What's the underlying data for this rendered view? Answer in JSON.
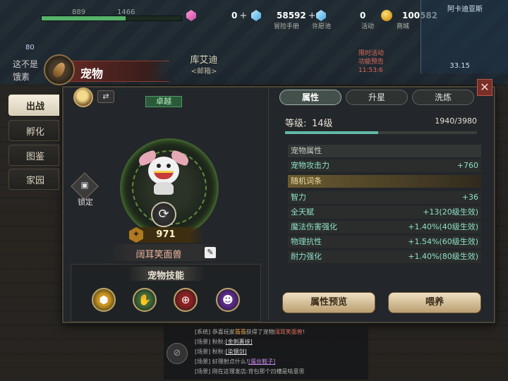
{
  "hud": {
    "hp_current": "889",
    "hp_max": "1466",
    "hp_fill_ratio": 0.6,
    "level": "80",
    "scrap_lines": [
      "这不是",
      "饿素"
    ],
    "currencies": [
      {
        "icon": "pink-crystal-icon",
        "value": "0",
        "plus": "+"
      },
      {
        "icon": "blue-crystal-icon",
        "value": "58592",
        "plus": "+"
      },
      {
        "icon": "blue-diamond-icon",
        "value": "0",
        "plus": ""
      },
      {
        "icon": "gold-coin-icon",
        "value": "100582",
        "plus": ""
      }
    ],
    "menu": [
      "冒险手册",
      "许愿池",
      "活动",
      "商城"
    ],
    "location": "阿卡迪亚斯",
    "time": "33.15",
    "npc_name": "库艾迪",
    "npc_sub": "<邮箱>",
    "npc_notes": [
      "限时活动",
      "功能预告",
      "11:53:6"
    ]
  },
  "panel": {
    "title": "宠物",
    "close_label": "✕",
    "side_tabs": [
      {
        "label": "出战",
        "active": true
      },
      {
        "label": "孵化",
        "active": false
      },
      {
        "label": "图鉴",
        "active": false
      },
      {
        "label": "家园",
        "active": false
      }
    ],
    "swap_label": "⇄",
    "quality": "卓越",
    "lock_label": "锁定",
    "refresh_glyph": "⟳",
    "power": "971",
    "pet_name": "阔耳笑面兽",
    "edit_glyph": "✎",
    "skills_title": "宠物技能",
    "skills": [
      {
        "icon": "golden-shield-skill-icon",
        "color": "#c9951f"
      },
      {
        "icon": "green-claw-skill-icon",
        "color": "#3e6b3a"
      },
      {
        "icon": "red-target-skill-icon",
        "color": "#8a2121"
      },
      {
        "icon": "purple-beast-skill-icon",
        "color": "#5a2a8a"
      }
    ]
  },
  "right": {
    "tabs": [
      {
        "label": "属性",
        "active": true
      },
      {
        "label": "升星",
        "active": false
      },
      {
        "label": "洗炼",
        "active": false
      }
    ],
    "level_label": "等级:",
    "level_value": "14级",
    "exp": "1940/3980",
    "exp_ratio": 0.487,
    "attr_section": "宠物属性",
    "attrs": [
      {
        "name": "宠物攻击力",
        "value": "+760"
      }
    ],
    "random_section": "随机词条",
    "random_attrs": [
      {
        "name": "智力",
        "value": "+36"
      },
      {
        "name": "全天赋",
        "value": "+13(20级生效)"
      },
      {
        "name": "魔法伤害强化",
        "value": "+1.40%(40级生效)"
      },
      {
        "name": "物理抗性",
        "value": "+1.54%(60级生效)"
      },
      {
        "name": "耐力强化",
        "value": "+1.40%(80级生效)"
      }
    ],
    "preview_button": "属性预览",
    "feed_button": "喂养"
  },
  "chat": {
    "lines": [
      {
        "channel": "[系统]",
        "parts": [
          {
            "t": "恭喜玩家",
            "c": "ch"
          },
          {
            "t": "翡翡",
            "c": "hl-gold"
          },
          {
            "t": "获得了宠物",
            "c": "ch"
          },
          {
            "t": "阔耳笑面兽",
            "c": "hl-red"
          },
          {
            "t": "!",
            "c": "ch"
          }
        ]
      },
      {
        "channel": "[场景]",
        "parts": [
          {
            "t": "秋秋:",
            "c": "ch"
          },
          {
            "t": "[金刺裹挟]",
            "c": "hl-white"
          }
        ]
      },
      {
        "channel": "[场景]",
        "parts": [
          {
            "t": "秋秋:",
            "c": "ch"
          },
          {
            "t": "[染钢剑]",
            "c": "hl-white"
          }
        ]
      },
      {
        "channel": "[场景]",
        "parts": [
          {
            "t": "好理射点什么!",
            "c": "ch"
          },
          {
            "t": "[蛋丝鞋子]",
            "c": "hl-purple"
          }
        ]
      },
      {
        "channel": "[场景]",
        "parts": [
          {
            "t": "刚在这理发店:背包那个凹槽是啥意思",
            "c": "ch"
          }
        ]
      }
    ]
  }
}
